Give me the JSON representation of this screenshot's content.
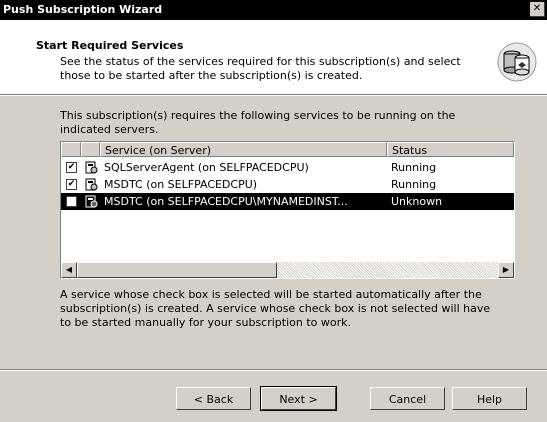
{
  "window": {
    "title": "Push Subscription Wizard",
    "close": "✕"
  },
  "header": {
    "title": "Start Required Services",
    "description": "See the status of the services required for this subscription(s) and select those to be started after the subscription(s) is created."
  },
  "intro": "This subscription(s) requires the following services to be running on the indicated servers.",
  "list": {
    "columns": [
      "",
      "Service (on Server)",
      "Status"
    ],
    "rows": [
      {
        "checked": "✔",
        "service": "SQLServerAgent (on SELFPACEDCPU)",
        "status": "Running",
        "selected": false
      },
      {
        "checked": "✔",
        "service": "MSDTC (on SELFPACEDCPU)",
        "status": "Running",
        "selected": false
      },
      {
        "checked": "",
        "service": "MSDTC (on SELFPACEDCPU\\MYNAMEDINST...",
        "status": "Unknown",
        "selected": true
      }
    ],
    "scroll_left": "◀",
    "scroll_right": "▶"
  },
  "note": "A service whose check box is selected will be started automatically after the subscription(s) is created. A service whose check box is not selected will have to be started manually for your subscription to work.",
  "buttons": {
    "back": "< Back",
    "next": "Next >",
    "cancel": "Cancel",
    "help": "Help"
  },
  "icons": {
    "logo": "server-database-icon",
    "service": "service-server-icon"
  }
}
